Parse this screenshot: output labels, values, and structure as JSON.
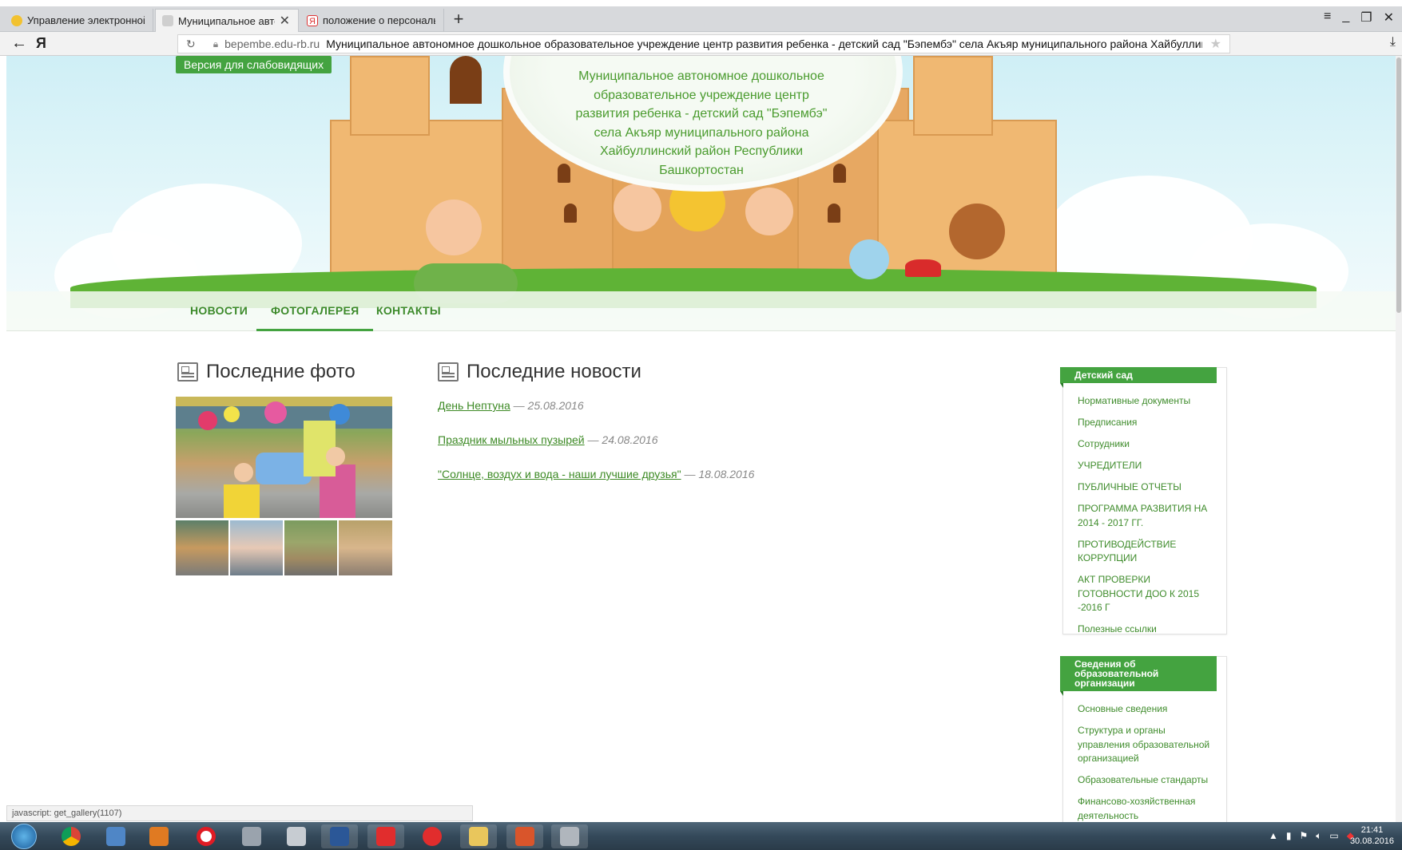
{
  "browser": {
    "tabs": [
      {
        "title": "Управление электронной с",
        "active": false
      },
      {
        "title": "Муниципальное автоном",
        "active": true
      },
      {
        "title": "положение о персональны",
        "active": false
      }
    ],
    "new_tab": "+",
    "address": {
      "domain": "bepembe.edu-rb.ru",
      "page_title": "Муниципальное автономное дошкольное образовательное учреждение центр развития ребенка - детский сад \"Бэпембэ\" села Акъяр муниципального района Хайбуллинский ра..."
    }
  },
  "header": {
    "low_vision_button": "Версия для слабовидящих",
    "site_title": "Муниципальное автономное дошкольное образовательное учреждение центр развития ребенка - детский сад \"Бэпембэ\" села Акъяр муниципального района Хайбуллинский район Республики Башкортостан"
  },
  "menu": {
    "items": [
      {
        "label": "НОВОСТИ",
        "active": false
      },
      {
        "label": "ФОТОГАЛЕРЕЯ",
        "active": true
      },
      {
        "label": "КОНТАКТЫ",
        "active": false
      }
    ]
  },
  "photos": {
    "heading": "Последние фото"
  },
  "news": {
    "heading": "Последние новости",
    "items": [
      {
        "title": "День Нептуна",
        "date": "— 25.08.2016"
      },
      {
        "title": "Праздник мыльных пузырей",
        "date": "— 24.08.2016"
      },
      {
        "title": "\"Солнце, воздух и вода - наши лучшие друзья\"",
        "date": "— 18.08.2016"
      }
    ]
  },
  "sidebar": {
    "widgets": [
      {
        "title": "Детский сад",
        "items": [
          "Нормативные документы",
          "Предписания",
          "Сотрудники",
          "УЧРЕДИТЕЛИ",
          "ПУБЛИЧНЫЕ ОТЧЕТЫ",
          "ПРОГРАММА РАЗВИТИЯ НА 2014 - 2017 ГГ.",
          "ПРОТИВОДЕЙСТВИЕ КОРРУПЦИИ",
          "АКТ ПРОВЕРКИ ГОТОВНОСТИ ДОО К 2015 -2016 Г",
          "Полезные ссылки"
        ]
      },
      {
        "title": "Сведения об образовательной организации",
        "items": [
          "Основные сведения",
          "Структура и органы управления образовательной организацией",
          "Образовательные стандарты",
          "Финансово-хозяйственная деятельность"
        ]
      }
    ]
  },
  "status_bar": "javascript: get_gallery(1107)",
  "taskbar": {
    "time": "21:41",
    "date": "30.08.2016"
  },
  "colors": {
    "accent": "#44a340",
    "link": "#3d8a25",
    "title_green": "#4a9b2e"
  }
}
